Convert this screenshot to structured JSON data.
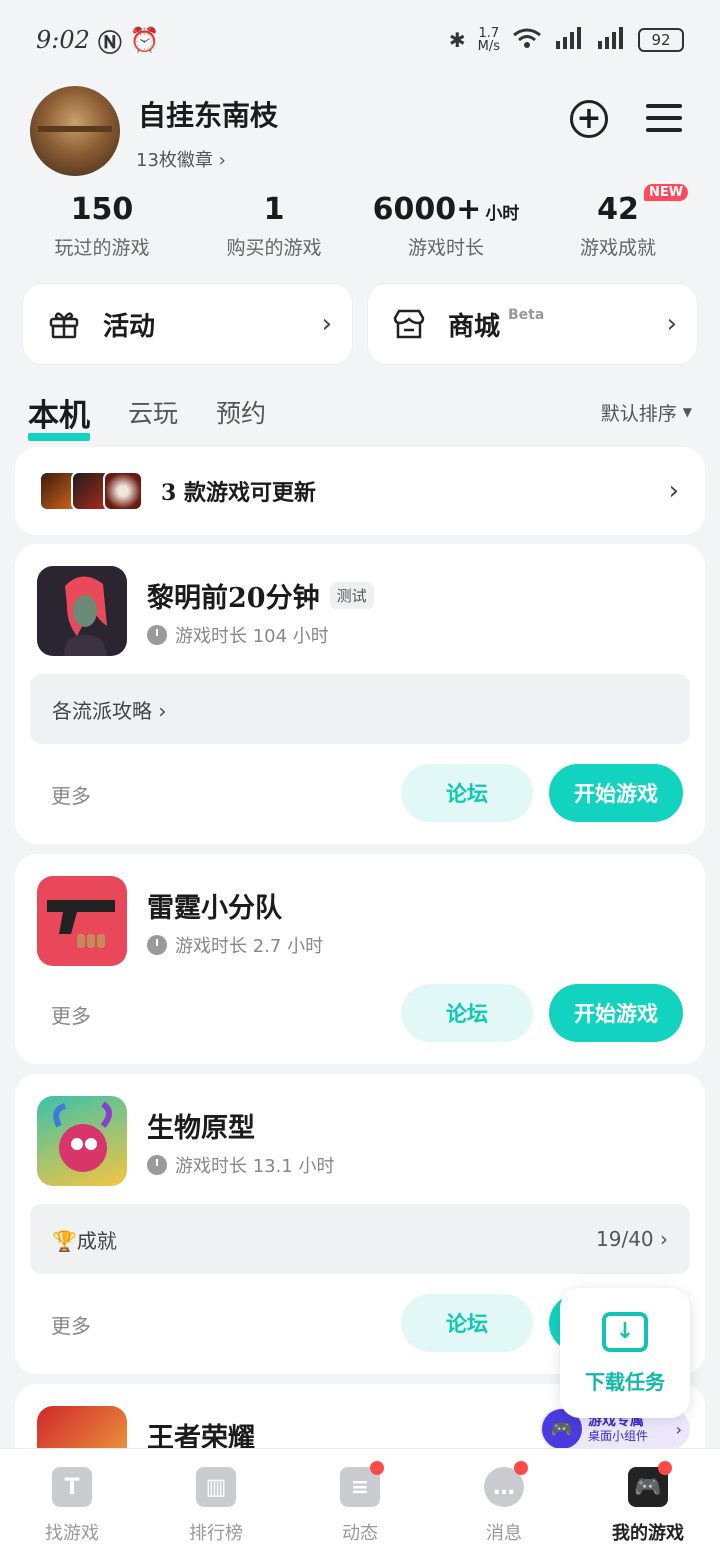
{
  "status": {
    "time": "9:02",
    "speed_value": "1.7",
    "speed_unit": "M/s",
    "battery": "92"
  },
  "profile": {
    "name": "自挂东南枝",
    "badges": "13枚徽章 ›"
  },
  "stats": [
    {
      "value": "150",
      "unit": "",
      "label": "玩过的游戏"
    },
    {
      "value": "1",
      "unit": "",
      "label": "购买的游戏"
    },
    {
      "value": "6000+",
      "unit": "小时",
      "label": "游戏时长"
    },
    {
      "value": "42",
      "unit": "",
      "label": "游戏成就",
      "badge": "NEW"
    }
  ],
  "quick": {
    "activity": "活动",
    "store": "商城",
    "store_beta": "Beta"
  },
  "tabs": {
    "local": "本机",
    "cloud": "云玩",
    "reserve": "预约",
    "sort": "默认排序"
  },
  "update": {
    "text": "3 款游戏可更新"
  },
  "games": [
    {
      "name": "黎明前20分钟",
      "tag": "测试",
      "playtime": "游戏时长 104 小时",
      "strip": "各流派攻略 ›",
      "more": "更多",
      "forum": "论坛",
      "play": "开始游戏"
    },
    {
      "name": "雷霆小分队",
      "playtime": "游戏时长 2.7 小时",
      "more": "更多",
      "forum": "论坛",
      "play": "开始游戏"
    },
    {
      "name": "生物原型",
      "playtime": "游戏时长 13.1 小时",
      "strip": "🏆成就",
      "strip_right": "19/40 ›",
      "more": "更多",
      "forum": "论坛"
    },
    {
      "name": "王者荣耀"
    }
  ],
  "float_download": {
    "label": "下载任务"
  },
  "widget": {
    "title": "游戏专属",
    "sub": "桌面小组件"
  },
  "nav": [
    {
      "label": "找游戏",
      "icon": "find-game-icon"
    },
    {
      "label": "排行榜",
      "icon": "ranking-icon"
    },
    {
      "label": "动态",
      "icon": "feed-icon"
    },
    {
      "label": "消息",
      "icon": "message-icon"
    },
    {
      "label": "我的游戏",
      "icon": "my-games-icon"
    }
  ],
  "colors": {
    "accent": "#12d3c0",
    "background": "#f3f4f6",
    "badge_red": "#ff4a5c"
  }
}
